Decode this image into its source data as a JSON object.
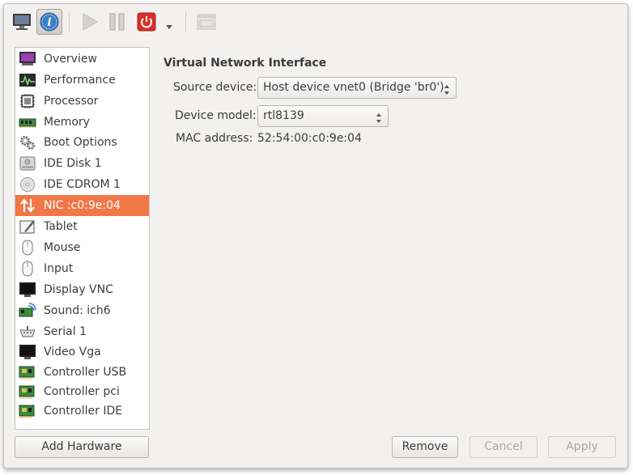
{
  "toolbar": {
    "buttons": [
      "monitor-icon",
      "info-icon",
      "play-icon",
      "pause-icon",
      "power-icon",
      "dropdown-arrow-icon",
      "fullscreen-icon"
    ]
  },
  "sidebar": {
    "items": [
      {
        "label": "Overview",
        "icon": "overview-icon"
      },
      {
        "label": "Performance",
        "icon": "performance-icon"
      },
      {
        "label": "Processor",
        "icon": "processor-icon"
      },
      {
        "label": "Memory",
        "icon": "memory-icon"
      },
      {
        "label": "Boot Options",
        "icon": "boot-options-icon"
      },
      {
        "label": "IDE Disk 1",
        "icon": "disk-icon"
      },
      {
        "label": "IDE CDROM 1",
        "icon": "cdrom-icon"
      },
      {
        "label": "NIC :c0:9e:04",
        "icon": "nic-icon",
        "selected": true
      },
      {
        "label": "Tablet",
        "icon": "tablet-icon"
      },
      {
        "label": "Mouse",
        "icon": "mouse-icon"
      },
      {
        "label": "Input",
        "icon": "input-icon"
      },
      {
        "label": "Display VNC",
        "icon": "display-icon"
      },
      {
        "label": "Sound: ich6",
        "icon": "sound-icon"
      },
      {
        "label": "Serial 1",
        "icon": "serial-icon"
      },
      {
        "label": "Video Vga",
        "icon": "video-icon"
      },
      {
        "label": "Controller USB",
        "icon": "controller-icon"
      },
      {
        "label": "Controller pci",
        "icon": "controller-icon"
      },
      {
        "label": "Controller IDE",
        "icon": "controller-icon"
      }
    ],
    "add_hardware_label": "Add Hardware"
  },
  "details": {
    "section_title": "Virtual Network Interface",
    "source_device_label": "Source device:",
    "source_device_value": "Host device vnet0 (Bridge 'br0')",
    "device_model_label": "Device model:",
    "device_model_value": "rtl8139",
    "mac_address_label": "MAC address:",
    "mac_address_value": "52:54:00:c0:9e:04"
  },
  "buttons": {
    "remove": "Remove",
    "cancel": "Cancel",
    "apply": "Apply"
  },
  "colors": {
    "selection": "#f07746",
    "window_bg": "#f2f1f0",
    "power_red": "#d9302a",
    "info_blue": "#3d7fc6"
  }
}
